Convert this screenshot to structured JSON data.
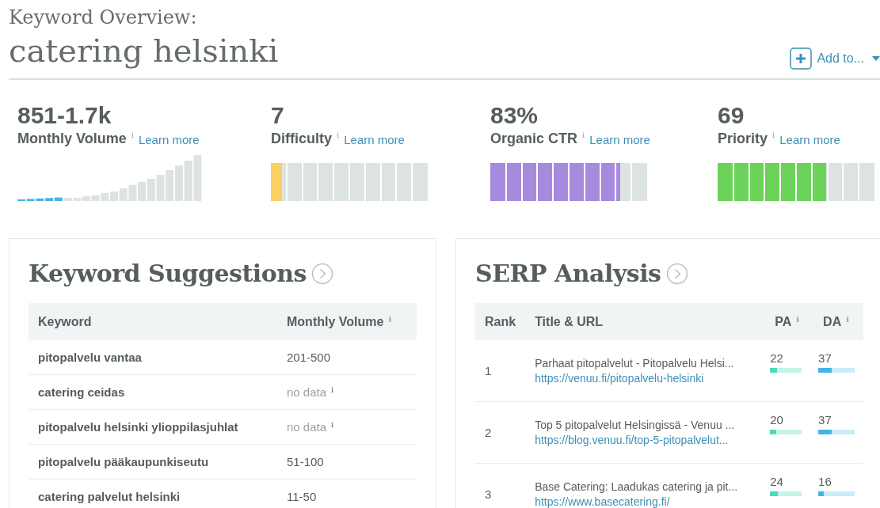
{
  "header": {
    "overline": "Keyword Overview:",
    "keyword": "catering helsinki",
    "add_button": {
      "label": "Add to..."
    }
  },
  "metrics": [
    {
      "kind": "histogram",
      "value": "851-1.7k",
      "label": "Monthly Volume",
      "info_mark": "i",
      "link": "Learn more"
    },
    {
      "kind": "segments",
      "value": "7",
      "label": "Difficulty",
      "info_mark": "i",
      "link": "Learn more",
      "level": 0.07,
      "color": "#fbd062"
    },
    {
      "kind": "segments",
      "value": "83%",
      "label": "Organic CTR",
      "info_mark": "i",
      "link": "Learn more",
      "level": 0.83,
      "color": "#a68add"
    },
    {
      "kind": "segments",
      "value": "69",
      "label": "Priority",
      "info_mark": "i",
      "link": "Learn more",
      "level": 0.69,
      "color": "#6bd35a"
    }
  ],
  "keyword_suggestions": {
    "title": "Keyword Suggestions",
    "columns": [
      {
        "label": "Keyword"
      },
      {
        "label": "Monthly Volume",
        "info_mark": "i"
      }
    ],
    "rows": [
      {
        "keyword": "pitopalvelu vantaa",
        "volume": "201-500",
        "muted": false
      },
      {
        "keyword": "catering ceidas",
        "volume": "no data",
        "muted": true,
        "info_mark": "i"
      },
      {
        "keyword": "pitopalvelu helsinki ylioppilasjuhlat",
        "volume": "no data",
        "muted": true,
        "info_mark": "i"
      },
      {
        "keyword": "pitopalvelu pääkaupunkiseutu",
        "volume": "51-100",
        "muted": false
      },
      {
        "keyword": "catering palvelut helsinki",
        "volume": "11-50",
        "muted": false
      }
    ]
  },
  "serp_analysis": {
    "title": "SERP Analysis",
    "columns": [
      {
        "label": "Rank"
      },
      {
        "label": "Title & URL"
      },
      {
        "label": "PA",
        "info_mark": "i"
      },
      {
        "label": "DA",
        "info_mark": "i"
      }
    ],
    "rows": [
      {
        "rank": "1",
        "title": "Parhaat pitopalvelut - Pitopalvelu Helsi...",
        "url": "https://venuu.fi/pitopalvelu-helsinki",
        "pa": {
          "value": "22",
          "level": 0.22
        },
        "da": {
          "value": "37",
          "level": 0.37
        }
      },
      {
        "rank": "2",
        "title": "Top 5 pitopalvelut Helsingissä - Venuu ...",
        "url": "https://blog.venuu.fi/top-5-pitopalvelut...",
        "pa": {
          "value": "20",
          "level": 0.2
        },
        "da": {
          "value": "37",
          "level": 0.37
        }
      },
      {
        "rank": "3",
        "title": "Base Catering: Laadukas catering ja pit...",
        "url": "https://www.basecatering.fi/",
        "pa": {
          "value": "24",
          "level": 0.24
        },
        "da": {
          "value": "16",
          "level": 0.16
        }
      }
    ]
  }
}
